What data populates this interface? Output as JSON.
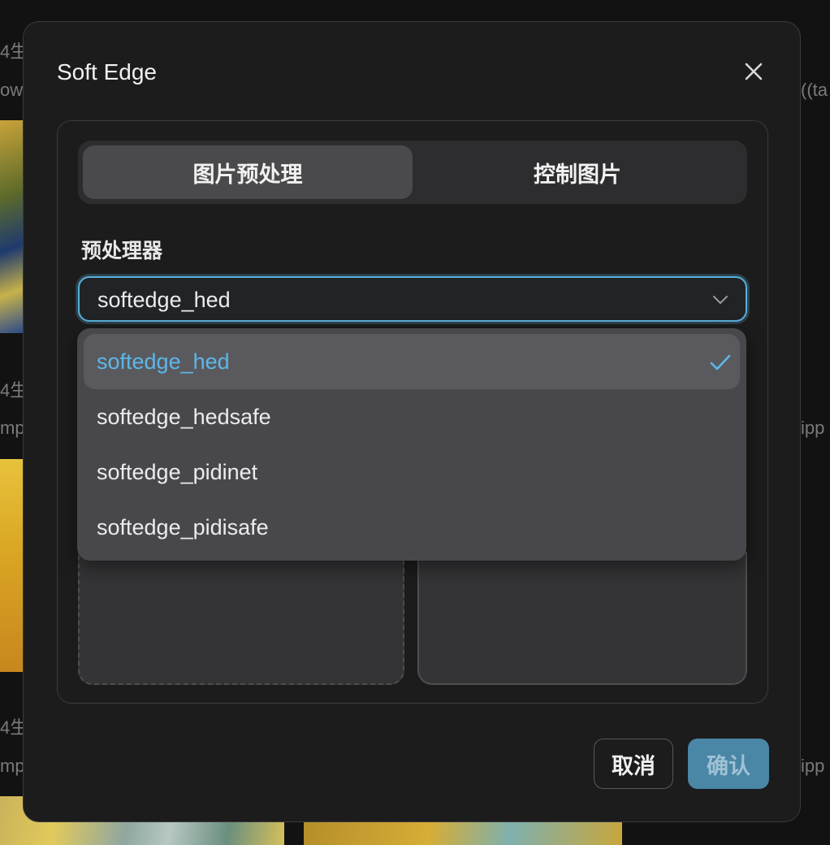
{
  "background": {
    "fragments": [
      "4生",
      "ow",
      "((ta",
      "4生",
      "mp",
      "ipp",
      "4生",
      "mp",
      "ipp"
    ]
  },
  "modal": {
    "title": "Soft Edge",
    "close_icon": "close-icon",
    "tabs": [
      {
        "label": "图片预处理",
        "active": true
      },
      {
        "label": "控制图片",
        "active": false
      }
    ],
    "preprocessor": {
      "label": "预处理器",
      "selected": "softedge_hed",
      "options": [
        {
          "label": "softedge_hed",
          "selected": true
        },
        {
          "label": "softedge_hedsafe",
          "selected": false
        },
        {
          "label": "softedge_pidinet",
          "selected": false
        },
        {
          "label": "softedge_pidisafe",
          "selected": false
        }
      ]
    },
    "buttons": {
      "cancel": "取消",
      "confirm": "确认"
    }
  },
  "colors": {
    "accent": "#5ab0dc",
    "confirm_bg": "#4a86a6",
    "modal_bg": "#1c1c1d"
  }
}
